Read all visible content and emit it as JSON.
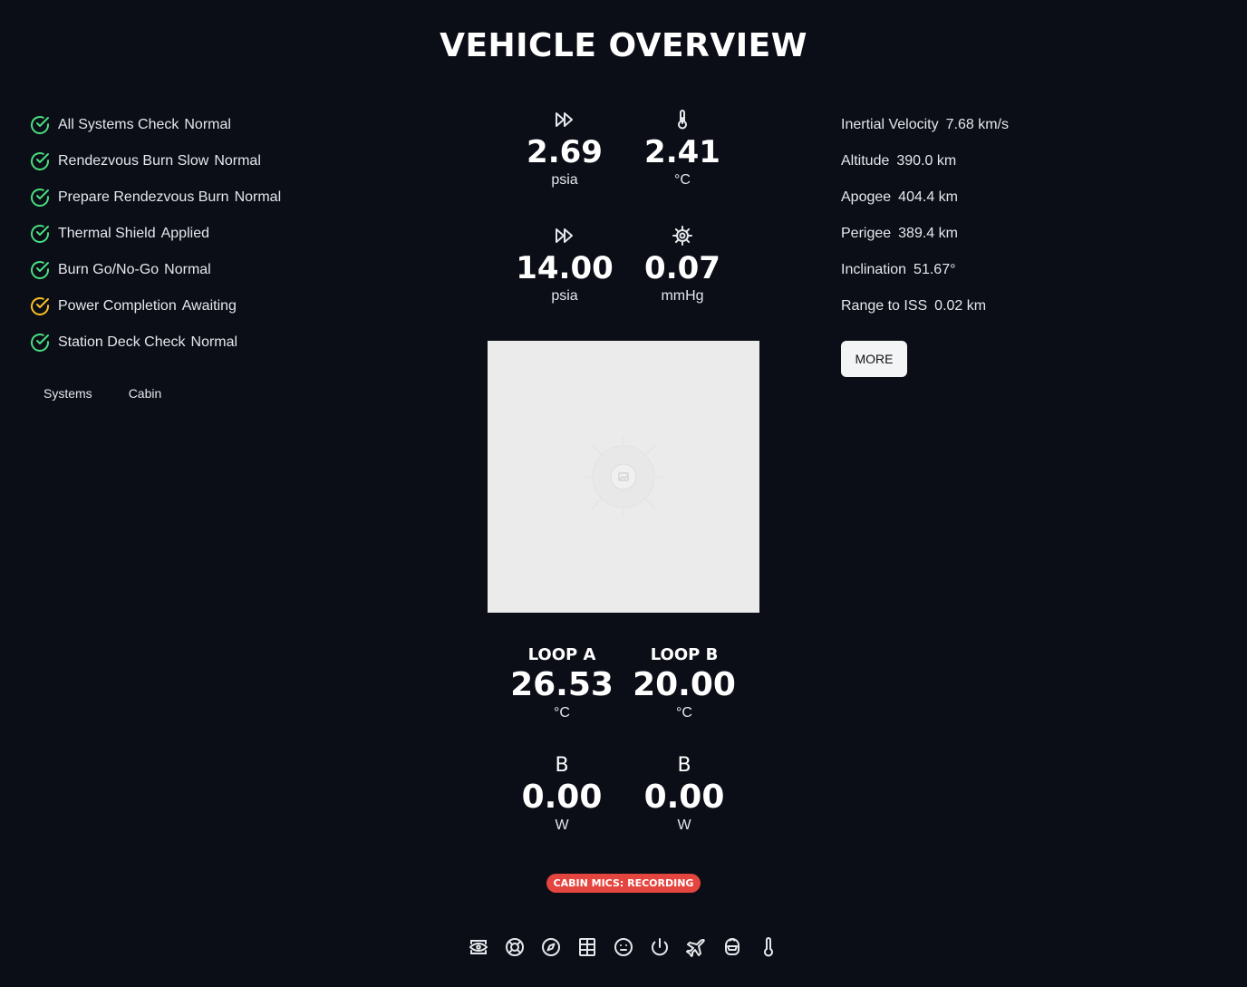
{
  "page": {
    "title": "VEHICLE OVERVIEW"
  },
  "checklist": [
    {
      "label": "All Systems Check",
      "status": "Normal",
      "state": "ok"
    },
    {
      "label": "Rendezvous Burn Slow",
      "status": "Normal",
      "state": "ok"
    },
    {
      "label": "Prepare Rendezvous Burn",
      "status": "Normal",
      "state": "ok"
    },
    {
      "label": "Thermal Shield",
      "status": "Applied",
      "state": "ok"
    },
    {
      "label": "Burn Go/No-Go",
      "status": "Normal",
      "state": "ok"
    },
    {
      "label": "Power Completion",
      "status": "Awaiting",
      "state": "pending"
    },
    {
      "label": "Station Deck Check",
      "status": "Normal",
      "state": "ok"
    }
  ],
  "colors": {
    "ok": "#4ade80",
    "pending": "#fbbf24",
    "badge": "#e5453f",
    "background": "#0b0e17"
  },
  "tabs": [
    {
      "label": "Systems"
    },
    {
      "label": "Cabin"
    }
  ],
  "gauges": [
    {
      "icon": "fast-forward-icon",
      "value": "2.69",
      "unit": "psia"
    },
    {
      "icon": "thermometer-icon",
      "value": "2.41",
      "unit": "°C"
    },
    {
      "icon": "fast-forward-icon",
      "value": "14.00",
      "unit": "psia"
    },
    {
      "icon": "gear-icon",
      "value": "0.07",
      "unit": "mmHg"
    }
  ],
  "loops": [
    {
      "label": "LOOP A",
      "value": "26.53",
      "unit": "°C"
    },
    {
      "label": "LOOP B",
      "value": "20.00",
      "unit": "°C"
    }
  ],
  "power": [
    {
      "label": "B",
      "value": "0.00",
      "unit": "W"
    },
    {
      "label": "B",
      "value": "0.00",
      "unit": "W"
    }
  ],
  "badge": {
    "text": "CABIN MICS: RECORDING"
  },
  "telemetry": [
    {
      "label": "Inertial Velocity",
      "value": "7.68 km/s"
    },
    {
      "label": "Altitude",
      "value": "390.0 km"
    },
    {
      "label": "Apogee",
      "value": "404.4 km"
    },
    {
      "label": "Perigee",
      "value": "389.4 km"
    },
    {
      "label": "Inclination",
      "value": "51.67°"
    },
    {
      "label": "Range to ISS",
      "value": "0.02 km"
    }
  ],
  "more_button": {
    "label": "MORE"
  },
  "bottom_icons": [
    "eye-icon",
    "lifebuoy-icon",
    "compass-icon",
    "grid-icon",
    "face-icon",
    "power-icon",
    "airplane-icon",
    "helmet-icon",
    "thermometer-icon"
  ]
}
